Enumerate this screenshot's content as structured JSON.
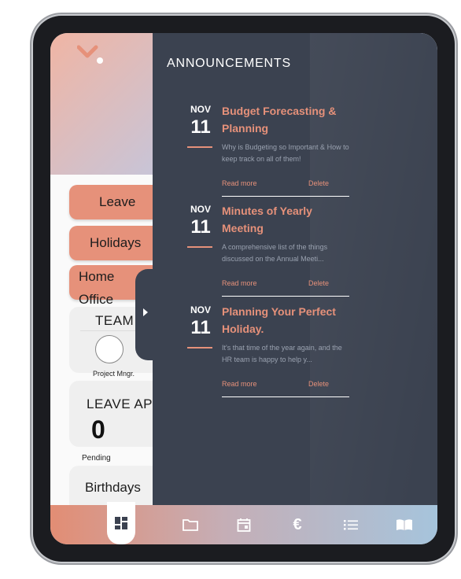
{
  "colors": {
    "accent": "#e6917a",
    "panel": "#3b4250",
    "excerpt": "#9aa2b0"
  },
  "left": {
    "menu": [
      {
        "label": "Leave"
      },
      {
        "label": "Holidays"
      },
      {
        "label": "Home\nOffice"
      }
    ],
    "team_title": "TEAM",
    "team_role": "Project Mngr.",
    "leave_title": "LEAVE AP",
    "leave_count": "0",
    "pending_label": "Pending",
    "birthdays_title": "Birthdays"
  },
  "announcements": {
    "title": "ANNOUNCEMENTS",
    "items": [
      {
        "month": "NOV",
        "day": "11",
        "headline": "Budget Forecasting & Planning",
        "excerpt": "Why is Budgeting so Important & How to keep track on all of them!",
        "read_more": "Read more",
        "delete": "Delete"
      },
      {
        "month": "NOV",
        "day": "11",
        "headline": "Minutes of Yearly Meeting",
        "excerpt": "A comprehensive list of the things discussed on the Annual Meeti...",
        "read_more": "Read more",
        "delete": "Delete"
      },
      {
        "month": "NOV",
        "day": "11",
        "headline": "Planning Your Perfect Holiday.",
        "excerpt": "It's that time of the year again, and the HR team is happy to help y...",
        "read_more": "Read more",
        "delete": "Delete"
      }
    ]
  },
  "bottom_nav": [
    {
      "icon": "dashboard-icon",
      "active": true
    },
    {
      "icon": "folder-icon",
      "active": false
    },
    {
      "icon": "calendar-icon",
      "active": false
    },
    {
      "icon": "euro-icon",
      "active": false
    },
    {
      "icon": "list-icon",
      "active": false
    },
    {
      "icon": "book-icon",
      "active": false
    }
  ]
}
